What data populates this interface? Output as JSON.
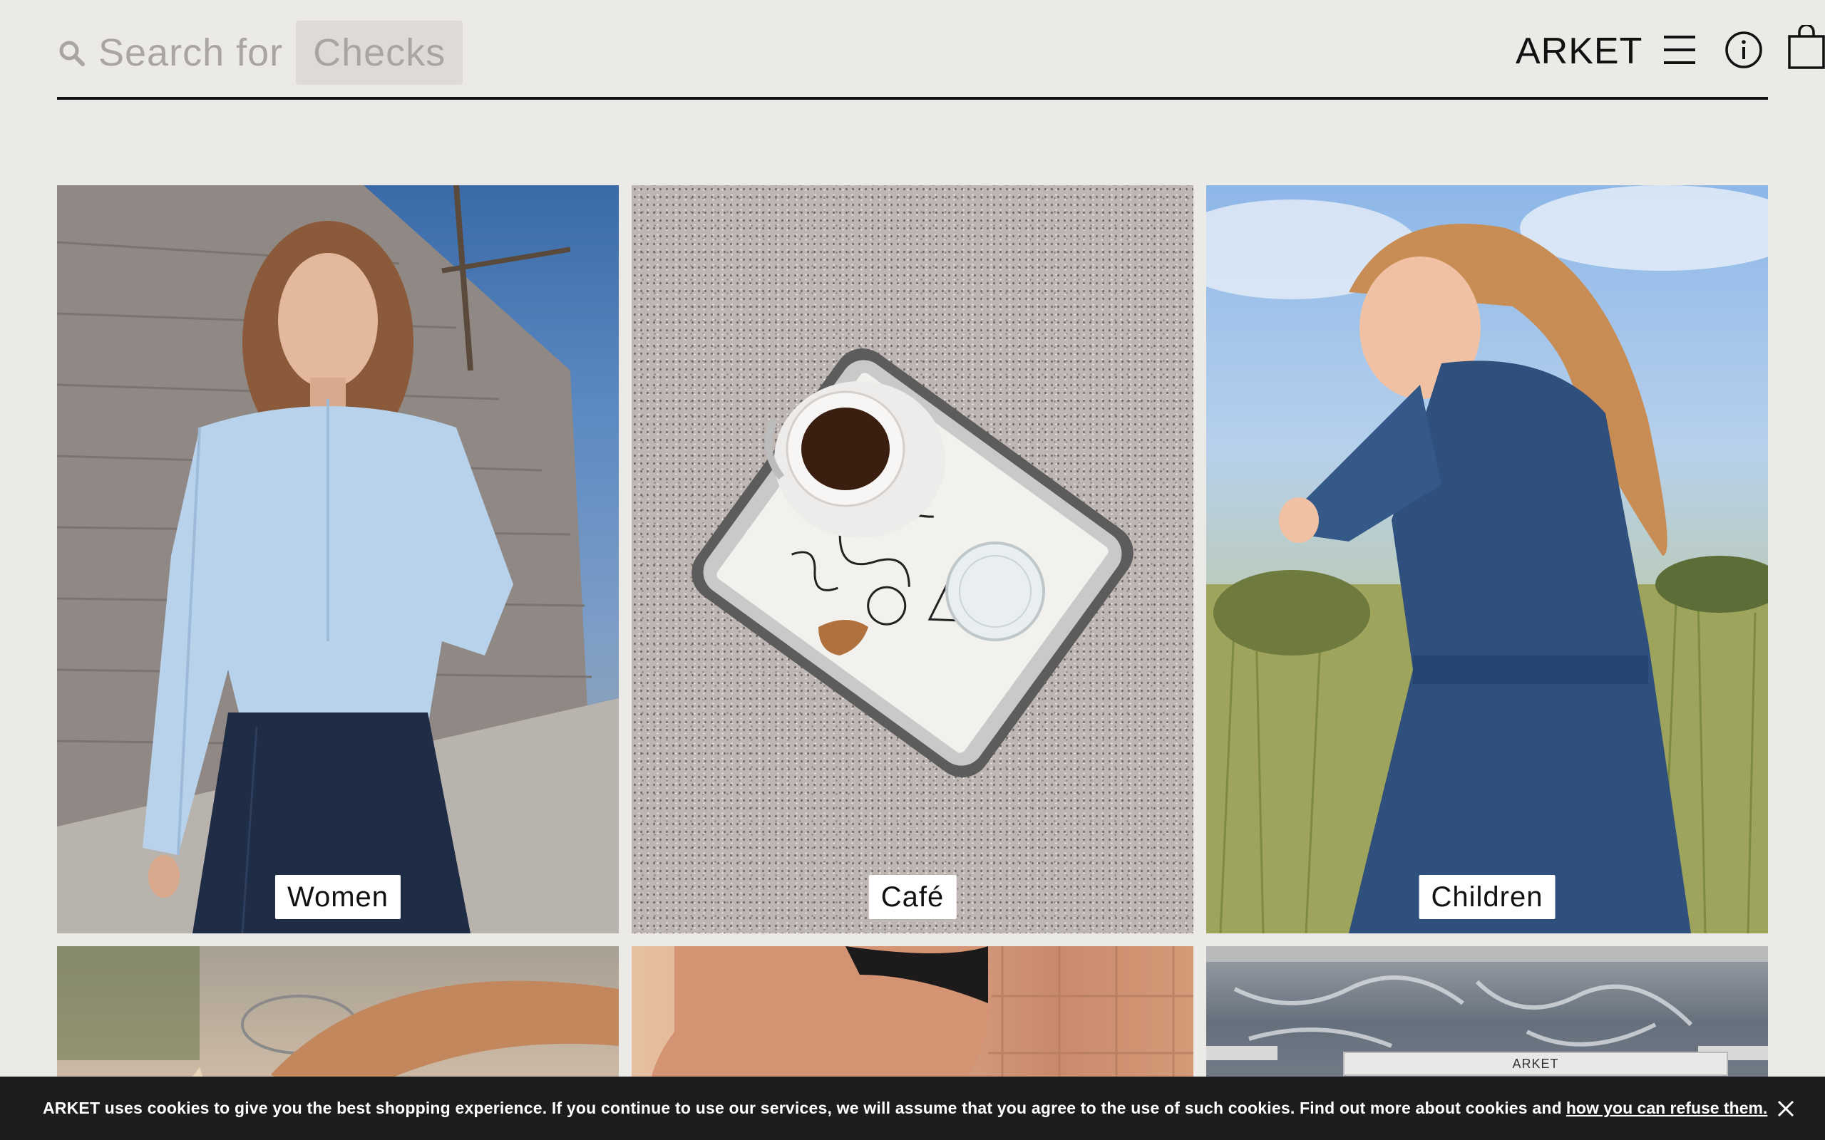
{
  "header": {
    "search_label": "Search for",
    "search_suggestion": "Checks",
    "brand": "ARKET",
    "icons": {
      "search": "search-icon",
      "menu": "hamburger-menu-icon",
      "info": "info-icon",
      "bag": "shopping-bag-icon"
    }
  },
  "tiles": [
    {
      "label": "Women",
      "image": "woman-in-light-blue-shirt-and-denim-skirt"
    },
    {
      "label": "Café",
      "image": "coffee-cup-on-tray-on-granite"
    },
    {
      "label": "Children",
      "image": "girl-in-denim-dress-in-field"
    }
  ],
  "row2": {
    "store_sign": "ARKET"
  },
  "cookie_bar": {
    "text": "ARKET uses cookies to give you the best shopping experience. If you continue to use our services, we will assume that you agree to the use of such cookies. Find out more about cookies and",
    "link_text": "how you can refuse them.",
    "close_icon": "close-icon"
  },
  "colors": {
    "background": "#eceae7",
    "text": "#111111",
    "placeholder": "#a9a6a2",
    "chip": "#dedbd7",
    "cookie_bar": "#1e1d1d"
  }
}
